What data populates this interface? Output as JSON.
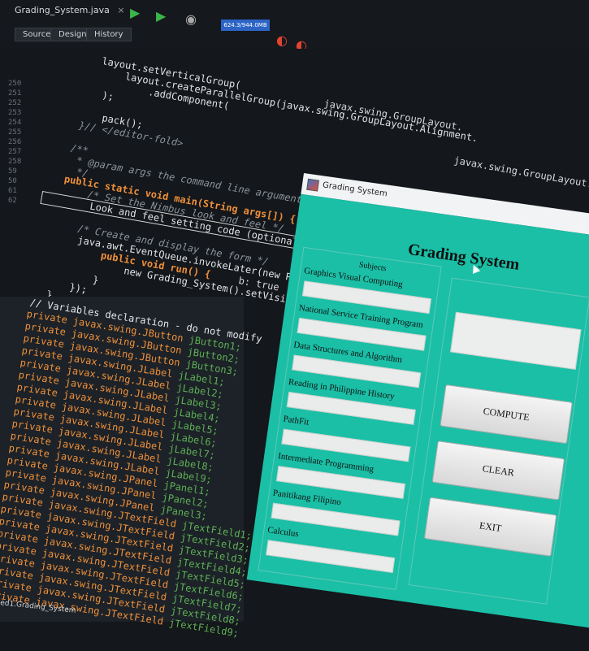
{
  "ide": {
    "file_tab": "Grading_System.java",
    "file_tab_close": "×",
    "view_tabs": [
      "Source",
      "Design",
      "History"
    ],
    "memory_indicator": "624.3/944.0MB",
    "line_numbers": [
      "250",
      "251",
      "252",
      "253",
      "254",
      "255",
      "256",
      "257",
      "258",
      "59",
      "50",
      "61",
      "62"
    ],
    "code_lines": [
      "        layout.setVerticalGroup(",
      "            layout.createParallelGroup(javax.swing.GroupLayout.Alignment.",
      "                .addComponent(",
      "        );",
      "",
      "        pack();",
      "    }// </editor-fold>",
      "",
      "    /**",
      "     * @param args the command line arguments",
      "     */",
      "    public static void main(String args[]) {",
      "        /* Set the Nimbus look and feel */",
      "        Look and feel setting code (optional)",
      "",
      "        /* Create and display the form */",
      "        java.awt.EventQueue.invokeLater(new Runnable() {",
      "            public void run() {",
      "                new Grading_System().setVisible(true);",
      "            }",
      "        });",
      "    }"
    ],
    "code_fragments": {
      "group_layout": "javax.swing.GroupLayout.",
      "group_layout_2": "javax.swing.GroupLayout.",
      "true_hint": "b: true"
    },
    "declarations_comment": "// Variables declaration - do not modify",
    "declarations": [
      {
        "type": "private javax.swing.JButton",
        "name": "jButton1;"
      },
      {
        "type": "private javax.swing.JButton",
        "name": "jButton2;"
      },
      {
        "type": "private javax.swing.JButton",
        "name": "jButton3;"
      },
      {
        "type": "private javax.swing.JLabel",
        "name": "jLabel1;"
      },
      {
        "type": "private javax.swing.JLabel",
        "name": "jLabel2;"
      },
      {
        "type": "private javax.swing.JLabel",
        "name": "jLabel3;"
      },
      {
        "type": "private javax.swing.JLabel",
        "name": "jLabel4;"
      },
      {
        "type": "private javax.swing.JLabel",
        "name": "jLabel5;"
      },
      {
        "type": "private javax.swing.JLabel",
        "name": "jLabel6;"
      },
      {
        "type": "private javax.swing.JLabel",
        "name": "jLabel7;"
      },
      {
        "type": "private javax.swing.JLabel",
        "name": "jLabel8;"
      },
      {
        "type": "private javax.swing.JLabel",
        "name": "jLabel9;"
      },
      {
        "type": "private javax.swing.JPanel",
        "name": "jPanel1;"
      },
      {
        "type": "private javax.swing.JPanel",
        "name": "jPanel2;"
      },
      {
        "type": "private javax.swing.JPanel",
        "name": "jPanel3;"
      },
      {
        "type": "private javax.swing.JTextField",
        "name": "jTextField1;"
      },
      {
        "type": "private javax.swing.JTextField",
        "name": "jTextField2;"
      },
      {
        "type": "private javax.swing.JTextField",
        "name": "jTextField3;"
      },
      {
        "type": "private javax.swing.JTextField",
        "name": "jTextField4;"
      },
      {
        "type": "private javax.swing.JTextField",
        "name": "jTextField5;"
      },
      {
        "type": "private javax.swing.JTextField",
        "name": "jTextField6;"
      },
      {
        "type": "private javax.swing.JTextField",
        "name": "jTextField7;"
      },
      {
        "type": "private javax.swing.JTextField",
        "name": "jTextField8;"
      },
      {
        "type": "private javax.swing.JTextField",
        "name": "jTextField9;"
      }
    ],
    "status_tab": "ed1.Grading_System"
  },
  "window": {
    "title": "Grading System",
    "minimize": "–",
    "maximize": "□",
    "heading": "Grading System",
    "subjects_header": "Subjects",
    "subjects": [
      "Graphics Visual Computing",
      "National Service Training Program",
      "Data Structures and Algorithm",
      "Reading in Philippine History",
      "PathFit",
      "Intermediate Programming",
      "Panitikang Filipino",
      "Calculus"
    ],
    "buttons": {
      "compute": "COMPUTE",
      "clear": "CLEAR",
      "exit": "EXIT"
    }
  },
  "colors": {
    "window_body": "#1abfa6",
    "ide_bg": "#14171b",
    "keyword": "#f0903a",
    "variable": "#5fb055"
  }
}
